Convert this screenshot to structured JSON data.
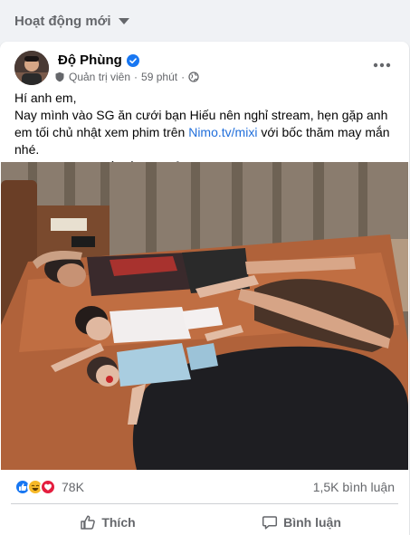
{
  "section": {
    "title": "Hoạt động mới",
    "caret_icon": "caret-down-icon"
  },
  "post": {
    "author": "Độ Phùng",
    "role": "Quản trị viên",
    "time": "59 phút",
    "text": {
      "line1": "Hí anh em,",
      "line2a": "Nay mình vào SG ăn cưới bạn Hiếu nên nghỉ stream, hẹn gặp anh em tối chủ nhật xem phim trên ",
      "link": "Nimo.tv/mixi",
      "line2b": " với bốc thăm may mắn nhé.",
      "line3": "Chúc anh em cuối tuần vui vẻ ",
      "heart": "❤"
    },
    "reactions_count": "78K",
    "comments_count": "1,5K bình luận",
    "actions": {
      "like": "Thích",
      "comment": "Bình luận"
    }
  },
  "colors": {
    "link": "#216fdb",
    "verified": "#1877f2",
    "like_blue": "#1877f2",
    "heart_red": "#e41e3f",
    "haha_yellow": "#f7b928"
  }
}
